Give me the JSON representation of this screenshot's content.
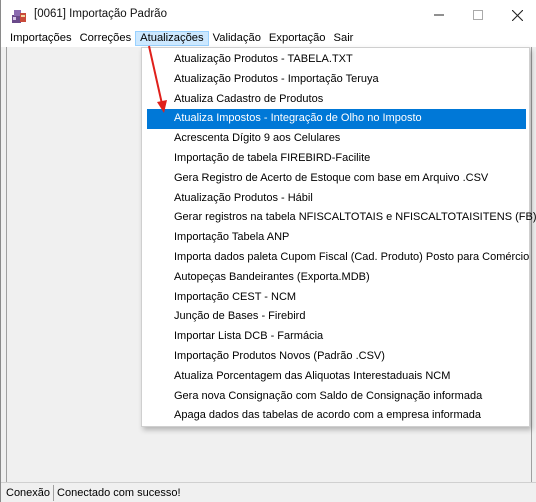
{
  "window": {
    "title": "[0061] Importação Padrão",
    "icon": "app-icon"
  },
  "menubar": {
    "items": [
      {
        "label": "Importações"
      },
      {
        "label": "Correções"
      },
      {
        "label": "Atualizações",
        "active": true
      },
      {
        "label": "Validação"
      },
      {
        "label": "Exportação"
      },
      {
        "label": "Sair"
      }
    ]
  },
  "dropdown": {
    "items": [
      {
        "label": "Atualização Produtos - TABELA.TXT"
      },
      {
        "label": "Atualização Produtos - Importação Teruya"
      },
      {
        "label": "Atualiza Cadastro de Produtos"
      },
      {
        "label": "Atualiza Impostos - Integração de Olho no Imposto",
        "highlighted": true
      },
      {
        "label": "Acrescenta Dígito 9 aos Celulares"
      },
      {
        "label": "Importação de tabela FIREBIRD-Facilite"
      },
      {
        "label": "Gera Registro de Acerto de Estoque com base em Arquivo .CSV"
      },
      {
        "label": "Atualização Produtos - Hábil"
      },
      {
        "label": "Gerar registros na tabela NFISCALTOTAIS e NFISCALTOTAISITENS (FB)"
      },
      {
        "label": "Importação Tabela ANP"
      },
      {
        "label": "Importa dados paleta Cupom Fiscal (Cad. Produto) Posto para Comércio"
      },
      {
        "label": "Autopeças Bandeirantes (Exporta.MDB)"
      },
      {
        "label": "Importação CEST - NCM"
      },
      {
        "label": "Junção de Bases - Firebird"
      },
      {
        "label": "Importar Lista DCB - Farmácia"
      },
      {
        "label": "Importação Produtos Novos (Padrão .CSV)"
      },
      {
        "label": "Atualiza Porcentagem das Aliquotas Interestaduais NCM"
      },
      {
        "label": "Gera nova Consignação com Saldo de Consignação informada"
      },
      {
        "label": "Apaga dados das tabelas de acordo com a empresa informada"
      }
    ]
  },
  "statusbar": {
    "label": "Conexão",
    "text": "Conectado com sucesso!"
  },
  "colors": {
    "highlight": "#0078d7",
    "menu_active": "#cce8ff",
    "annotation_arrow": "#e0201b"
  }
}
